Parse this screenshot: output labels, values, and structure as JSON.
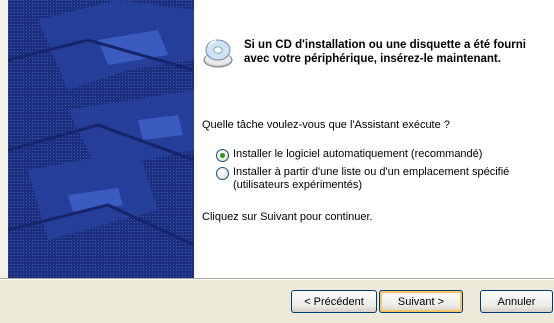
{
  "content": {
    "heading": "Si un CD d'installation ou une disquette a été fourni avec votre périphérique, insérez-le maintenant.",
    "question": "Quelle tâche voulez-vous que l'Assistant exécute ?",
    "options": [
      {
        "label": "Installer le logiciel automatiquement (recommandé)",
        "selected": true
      },
      {
        "label": "Installer à partir d'une liste ou d'un emplacement spécifié (utilisateurs expérimentés)",
        "selected": false
      }
    ],
    "hint": "Cliquez sur Suivant pour continuer."
  },
  "buttons": {
    "prev": "< Précédent",
    "next": "Suivant >",
    "cancel": "Annuler"
  },
  "icons": {
    "cd": "cd-disk-icon"
  },
  "colors": {
    "banner": "#1b2f7e",
    "radio_selected": "#2c9a1a",
    "default_button_focus": "#f6c762"
  }
}
